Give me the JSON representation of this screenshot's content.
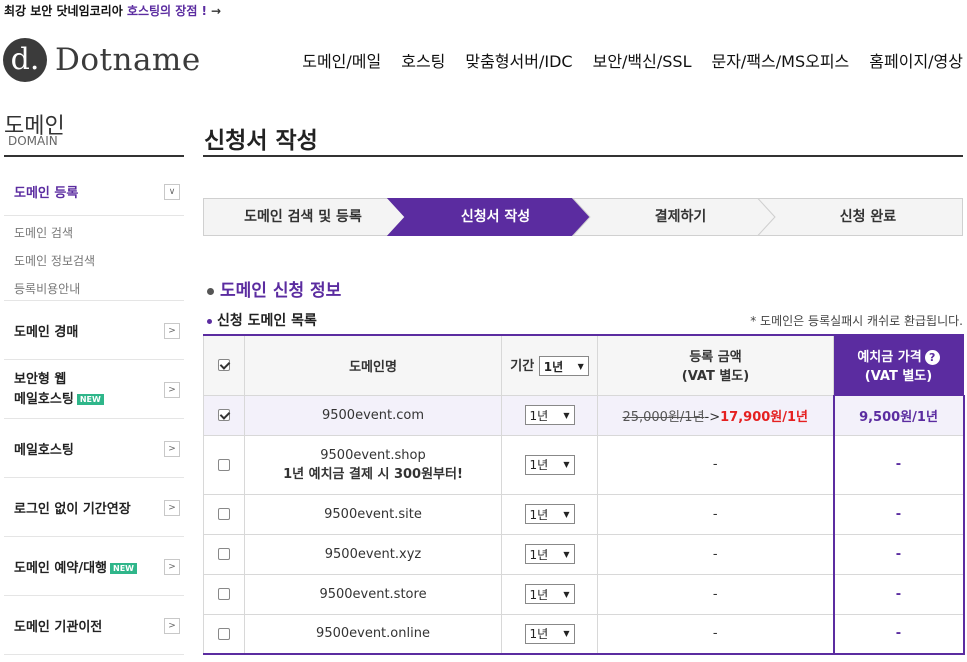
{
  "promo": {
    "text": "최강 보안 닷네임코리아 ",
    "highlight": "호스팅의 장점 !",
    "arrow": "→"
  },
  "logo": {
    "mark": "d.",
    "text": "Dotname"
  },
  "gnb": [
    "도메인/메일",
    "호스팅",
    "맞춤형서버/IDC",
    "보안/백신/SSL",
    "문자/팩스/MS오피스",
    "홈페이지/영상"
  ],
  "sidebar": {
    "title": "도메인",
    "subtitle": "DOMAIN",
    "items": [
      {
        "label": "도메인 등록",
        "toggle": "∨",
        "active": true
      },
      {
        "label": "도메인 경매",
        "toggle": ">"
      },
      {
        "label": "보안형 웹",
        "label2": "메일호스팅",
        "badge": "NEW",
        "toggle": ">"
      },
      {
        "label": "메일호스팅",
        "toggle": ">"
      },
      {
        "label": "로그인 없이 기간연장",
        "toggle": ">"
      },
      {
        "label": "도메인 예약/대행",
        "badge": "NEW",
        "toggle": ">"
      },
      {
        "label": "도메인 기관이전",
        "toggle": ">"
      }
    ],
    "sub_items": [
      "도메인 검색",
      "도메인 정보검색",
      "등록비용안내"
    ]
  },
  "page_title": "신청서 작성",
  "steps": [
    "도메인 검색 및 등록",
    "신청서 작성",
    "결제하기",
    "신청 완료"
  ],
  "section_title": "도메인 신청 정보",
  "list_title": "신청 도메인 목록",
  "notice": "* 도메인은 등록실패시 캐쉬로 환급됩니다.",
  "table": {
    "head": {
      "domain": "도메인명",
      "period": "기간",
      "period_value": "1년",
      "price": "등록 금액",
      "price_sub": "(VAT 별도)",
      "deposit": "예치금 가격",
      "deposit_sub": "(VAT 별도)",
      "help": "?"
    },
    "rows": [
      {
        "domain": "9500event.com",
        "period": "1년",
        "price_old": "25,000원/1년",
        "price_arrow": "->",
        "price_new": "17,900원/1년",
        "deposit": "9,500원/1년",
        "checked": true
      },
      {
        "domain": "9500event.shop",
        "promo": "1년 예치금 결제 시 300원부터!",
        "period": "1년",
        "price": "-",
        "deposit": "-"
      },
      {
        "domain": "9500event.site",
        "period": "1년",
        "price": "-",
        "deposit": "-"
      },
      {
        "domain": "9500event.xyz",
        "period": "1년",
        "price": "-",
        "deposit": "-"
      },
      {
        "domain": "9500event.store",
        "period": "1년",
        "price": "-",
        "deposit": "-"
      },
      {
        "domain": "9500event.online",
        "period": "1년",
        "price": "-",
        "deposit": "-"
      }
    ]
  },
  "caret": "▼",
  "colors": {
    "accent": "#5b2ca0",
    "price_red": "#e52020",
    "badge_green": "#2fb68a"
  }
}
